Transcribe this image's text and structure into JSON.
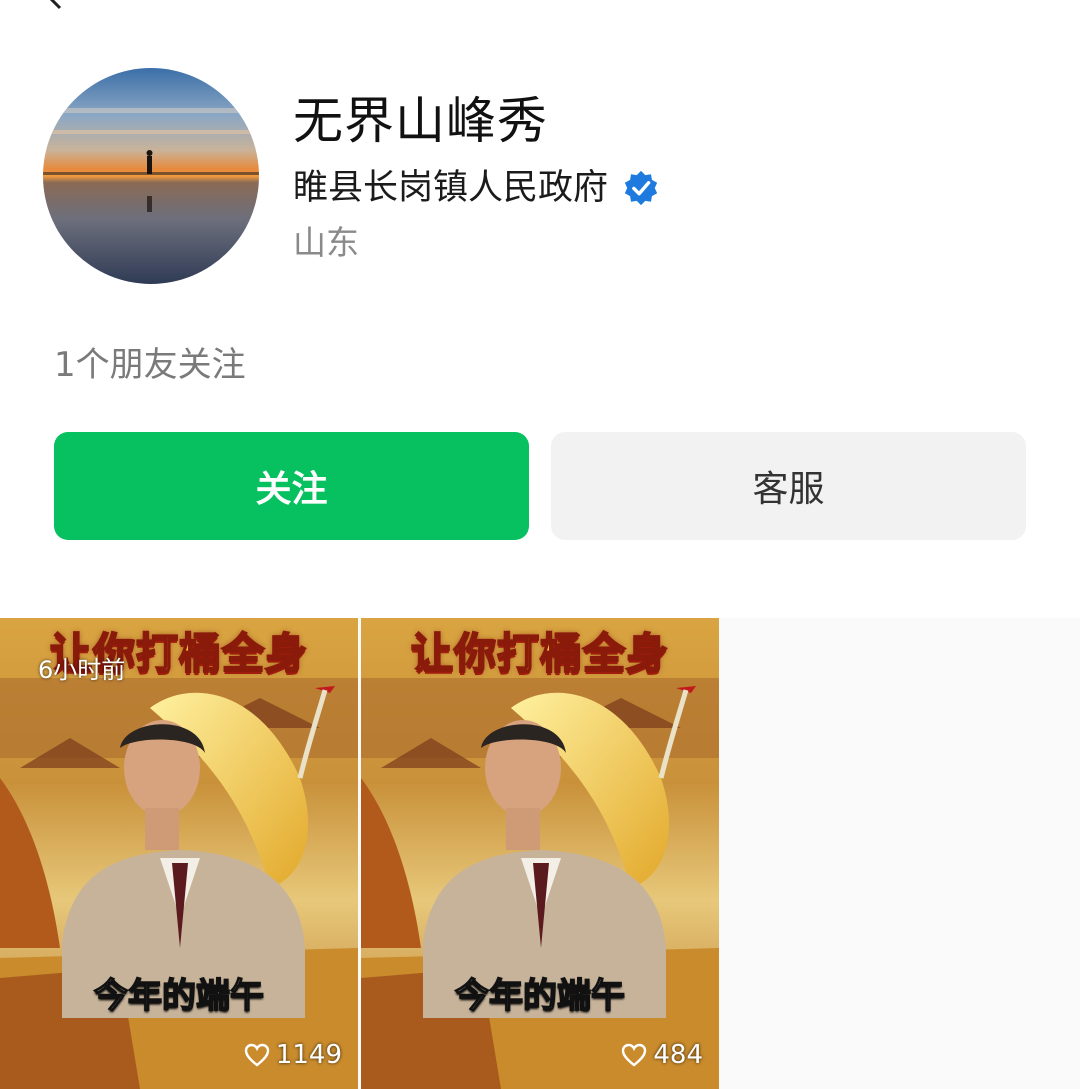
{
  "profile": {
    "name": "无界山峰秀",
    "organization": "睢县长岗镇人民政府",
    "region": "山东",
    "friends_following": "1个朋友关注"
  },
  "buttons": {
    "follow_label": "关注",
    "service_label": "客服"
  },
  "colors": {
    "follow_green": "#07c160",
    "verified_blue": "#1f7ae0"
  },
  "videos": [
    {
      "title": "让你打桶全身",
      "time": "6小时前",
      "caption": "今年的端午",
      "likes": "1149"
    },
    {
      "title": "让你打桶全身",
      "caption": "今年的端午",
      "likes": "484"
    }
  ]
}
